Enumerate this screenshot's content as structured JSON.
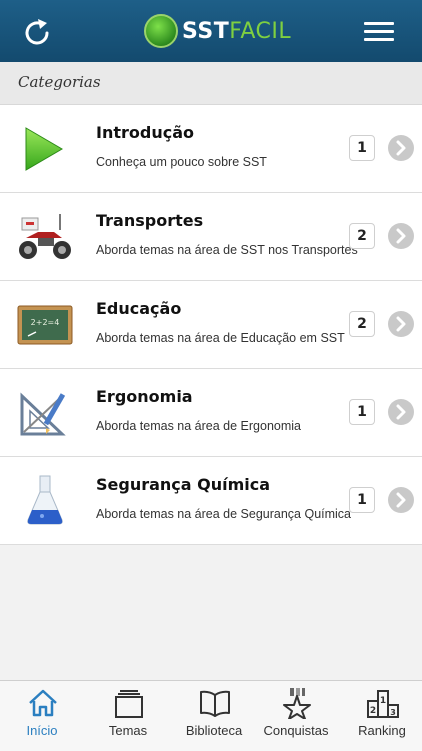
{
  "header": {
    "logo_bold": "SST",
    "logo_light": "FACIL"
  },
  "categories_label": "Categorias",
  "items": [
    {
      "title": "Introdução",
      "subtitle": "Conheça um pouco sobre SST",
      "count": "1",
      "icon": "play-icon"
    },
    {
      "title": "Transportes",
      "subtitle": "Aborda temas na área de SST nos Transportes",
      "count": "2",
      "icon": "motorcycle-icon"
    },
    {
      "title": "Educação",
      "subtitle": "Aborda temas na área de Educação em SST",
      "count": "2",
      "icon": "chalkboard-icon"
    },
    {
      "title": "Ergonomia",
      "subtitle": "Aborda temas na área de Ergonomia",
      "count": "1",
      "icon": "drafting-tools-icon"
    },
    {
      "title": "Segurança Química",
      "subtitle": "Aborda temas na área de Segurança Química",
      "count": "1",
      "icon": "flask-icon"
    }
  ],
  "chalkboard_text": "2+2=4",
  "tabs": [
    {
      "label": "Início",
      "icon": "home-icon",
      "active": true
    },
    {
      "label": "Temas",
      "icon": "layers-icon",
      "active": false
    },
    {
      "label": "Biblioteca",
      "icon": "book-icon",
      "active": false
    },
    {
      "label": "Conquistas",
      "icon": "star-trophy-icon",
      "active": false
    },
    {
      "label": "Ranking",
      "icon": "podium-icon",
      "active": false
    }
  ],
  "podium_numbers": [
    "2",
    "1",
    "3"
  ],
  "colors": {
    "header": "#1a5a82",
    "accent": "#2b7fc0",
    "logo_green": "#7fd040"
  }
}
